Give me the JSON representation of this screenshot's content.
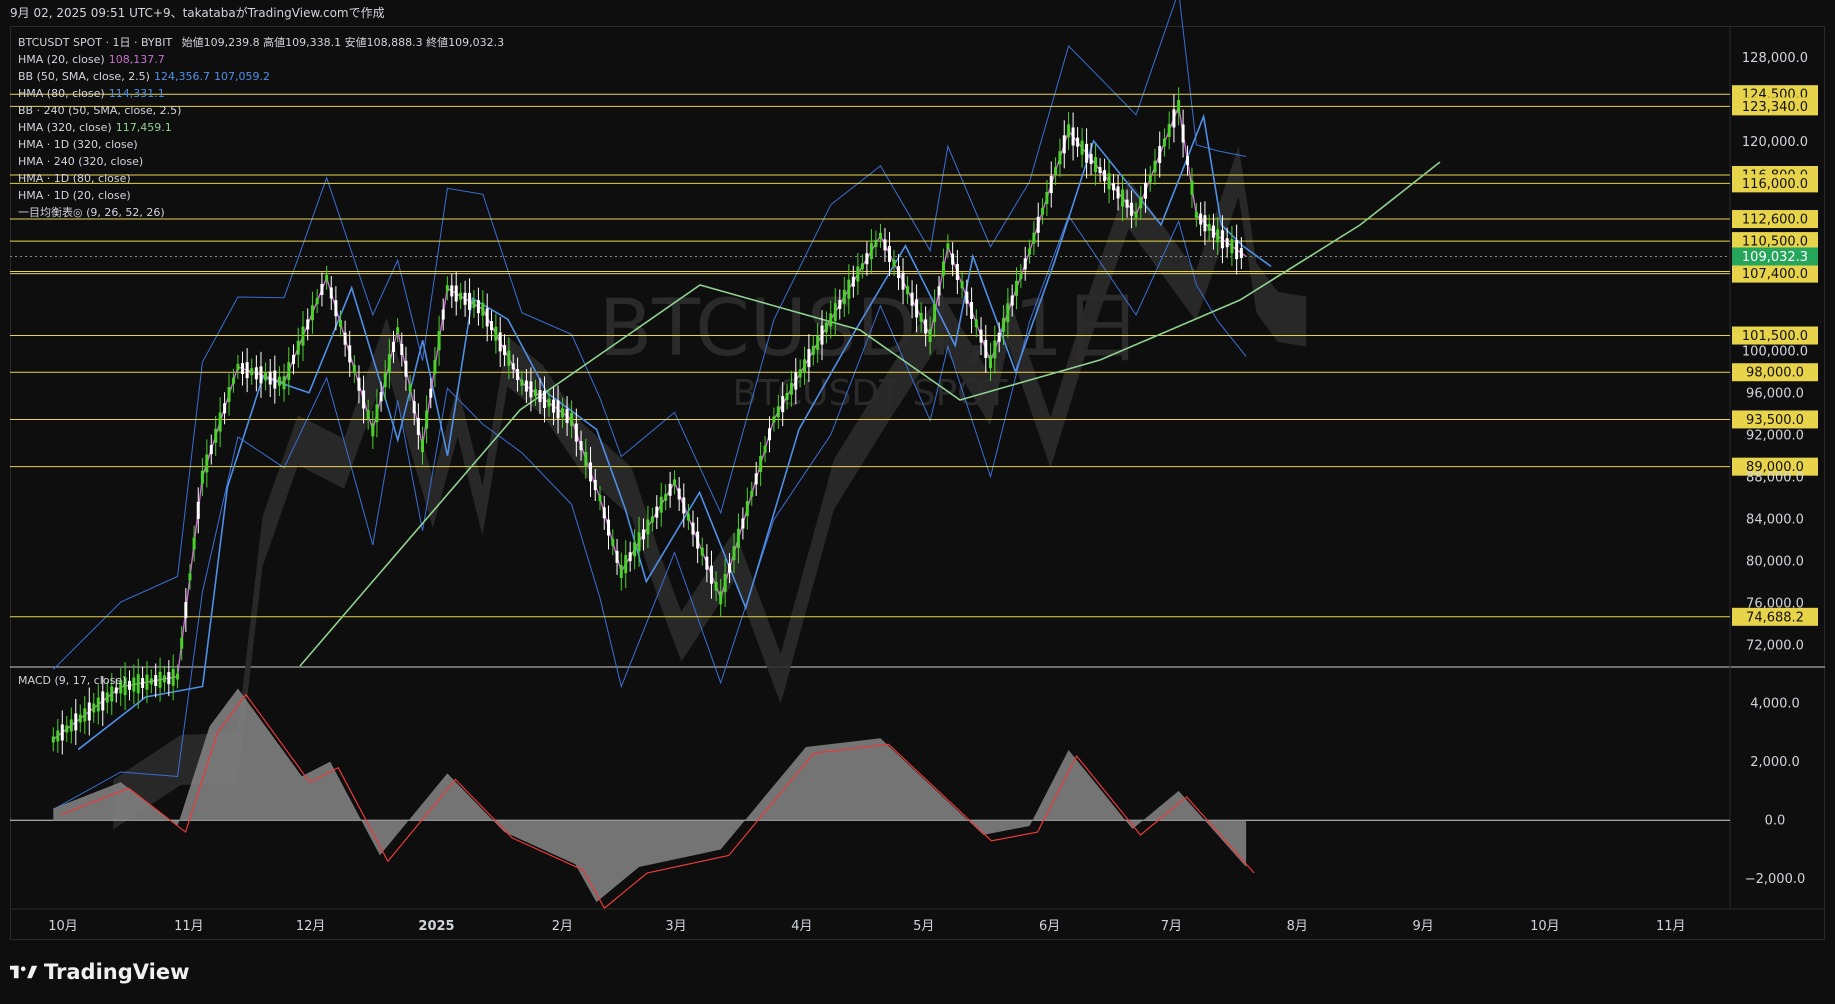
{
  "header": {
    "caption": "9月 02, 2025 09:51 UTC+9、takatabaがTradingView.comで作成"
  },
  "legend": {
    "symbol_line": "BTCUSDT SPOT · 1日 · BYBIT",
    "ohlc": {
      "open_label": "始値",
      "open": "109,239.8",
      "high_label": "高値",
      "high": "109,338.1",
      "low_label": "安値",
      "low": "108,888.3",
      "close_label": "終値",
      "close": "109,032.3"
    },
    "indicators": [
      {
        "label": "HMA (20, close)",
        "values": [
          "108,137.7"
        ],
        "colors": [
          "#c96fd0"
        ]
      },
      {
        "label": "BB (50, SMA, close, 2.5)",
        "values": [
          "124,356.7",
          "107,059.2"
        ],
        "colors": [
          "#4f8fe6",
          "#4f8fe6"
        ]
      },
      {
        "label": "HMA (80, close)",
        "values": [
          "114,331.1"
        ],
        "colors": [
          "#4f8fe6"
        ]
      },
      {
        "label": "BB · 240 (50, SMA, close, 2.5)",
        "values": [],
        "colors": []
      },
      {
        "label": "HMA (320, close)",
        "values": [
          "117,459.1"
        ],
        "colors": [
          "#8fd18f"
        ]
      },
      {
        "label": "HMA · 1D (320, close)",
        "values": [],
        "colors": []
      },
      {
        "label": "HMA · 240 (320, close)",
        "values": [],
        "colors": []
      },
      {
        "label": "HMA · 1D (80, close)",
        "values": [],
        "colors": []
      },
      {
        "label": "HMA · 1D (20, close)",
        "values": [],
        "colors": []
      },
      {
        "label": "一目均衡表◎ (9, 26, 52, 26)",
        "values": [],
        "colors": []
      }
    ]
  },
  "watermark": {
    "big": "BTCUSDT, 1日",
    "small": "BTCUSDT SPOT"
  },
  "macd": {
    "label": "MACD (9, 17, close)"
  },
  "footer": {
    "brand": "TradingView"
  },
  "colors": {
    "bg": "#0e0e0e",
    "up": "#4ad12a",
    "down": "#ffffff",
    "level": "#e8d44a",
    "hma20": "#c96fd0",
    "hma80": "#4f8fe6",
    "hma320": "#8fd18f",
    "bb": "#3b6fd6",
    "macd_hist": "#808080",
    "macd_signal": "#e83a3a",
    "last_price": "#26a65b"
  },
  "chart_data": {
    "type": "line",
    "title": "BTCUSDT SPOT · 1日 · BYBIT",
    "y_axis": {
      "ylim": [
        70000,
        131000
      ],
      "ticks": [
        {
          "v": 128000,
          "t": "128,000.0"
        },
        {
          "v": 120000,
          "t": "120,000.0"
        },
        {
          "v": 100000,
          "t": "100,000.0"
        },
        {
          "v": 96000,
          "t": "96,000.0"
        },
        {
          "v": 92000,
          "t": "92,000.0"
        },
        {
          "v": 88000,
          "t": "88,000.0"
        },
        {
          "v": 84000,
          "t": "84,000.0"
        },
        {
          "v": 80000,
          "t": "80,000.0"
        },
        {
          "v": 76000,
          "t": "76,000.0"
        },
        {
          "v": 72000,
          "t": "72,000.0"
        }
      ]
    },
    "x_axis": {
      "labels": [
        {
          "t": "10月",
          "d": 0
        },
        {
          "t": "11月",
          "d": 31
        },
        {
          "t": "12月",
          "d": 61
        },
        {
          "t": "2025",
          "d": 92
        },
        {
          "t": "2月",
          "d": 123
        },
        {
          "t": "3月",
          "d": 151
        },
        {
          "t": "4月",
          "d": 182
        },
        {
          "t": "5月",
          "d": 212
        },
        {
          "t": "6月",
          "d": 243
        },
        {
          "t": "7月",
          "d": 273
        },
        {
          "t": "8月",
          "d": 304
        },
        {
          "t": "9月",
          "d": 335
        },
        {
          "t": "10月",
          "d": 365
        },
        {
          "t": "11月",
          "d": 396
        }
      ]
    },
    "levels": [
      {
        "v": 124500,
        "t": "124,500.0"
      },
      {
        "v": 123340,
        "t": "123,340.0"
      },
      {
        "v": 116800,
        "t": "116,800.0"
      },
      {
        "v": 116000,
        "t": "116,000.0"
      },
      {
        "v": 112600,
        "t": "112,600.0"
      },
      {
        "v": 110500,
        "t": "110,500.0"
      },
      {
        "v": 107600,
        "t": "107,600.0"
      },
      {
        "v": 107400,
        "t": "107,400.0"
      },
      {
        "v": 101500,
        "t": "101,500.0"
      },
      {
        "v": 98000,
        "t": "98,000.0"
      },
      {
        "v": 93500,
        "t": "93,500.0"
      },
      {
        "v": 89000,
        "t": "89,000.0"
      },
      {
        "v": 74688.2,
        "t": "74,688.2"
      }
    ],
    "last_price": {
      "v": 109032.3,
      "t": "109,032.3"
    },
    "price_path": [
      {
        "x": "2024-10-01",
        "y": 63000
      },
      {
        "x": "2024-10-20",
        "y": 68000
      },
      {
        "x": "2024-11-05",
        "y": 69000
      },
      {
        "x": "2024-11-12",
        "y": 88000
      },
      {
        "x": "2024-11-22",
        "y": 98500
      },
      {
        "x": "2024-12-05",
        "y": 97000
      },
      {
        "x": "2024-12-17",
        "y": 107000
      },
      {
        "x": "2024-12-30",
        "y": 92500
      },
      {
        "x": "2025-01-06",
        "y": 102000
      },
      {
        "x": "2025-01-13",
        "y": 91000
      },
      {
        "x": "2025-01-20",
        "y": 106000
      },
      {
        "x": "2025-01-30",
        "y": 104000
      },
      {
        "x": "2025-02-10",
        "y": 97000
      },
      {
        "x": "2025-02-24",
        "y": 93500
      },
      {
        "x": "2025-03-04",
        "y": 86000
      },
      {
        "x": "2025-03-10",
        "y": 79000
      },
      {
        "x": "2025-03-25",
        "y": 87500
      },
      {
        "x": "2025-04-07",
        "y": 76500
      },
      {
        "x": "2025-04-22",
        "y": 93500
      },
      {
        "x": "2025-05-08",
        "y": 103000
      },
      {
        "x": "2025-05-22",
        "y": 111000
      },
      {
        "x": "2025-06-05",
        "y": 101500
      },
      {
        "x": "2025-06-10",
        "y": 110000
      },
      {
        "x": "2025-06-22",
        "y": 99000
      },
      {
        "x": "2025-07-03",
        "y": 109500
      },
      {
        "x": "2025-07-14",
        "y": 121000
      },
      {
        "x": "2025-08-02",
        "y": 113000
      },
      {
        "x": "2025-08-14",
        "y": 123340
      },
      {
        "x": "2025-08-19",
        "y": 113000
      },
      {
        "x": "2025-08-25",
        "y": 111000
      },
      {
        "x": "2025-09-02",
        "y": 109032
      }
    ],
    "macd_axis": {
      "ylim": [
        -3000,
        5200
      ],
      "ticks": [
        {
          "v": 4000,
          "t": "4,000.0"
        },
        {
          "v": 2000,
          "t": "2,000.0"
        },
        {
          "v": 0,
          "t": "0.0"
        },
        {
          "v": -2000,
          "t": "−2,000.0"
        }
      ]
    },
    "macd_path": [
      {
        "x": "2024-10-01",
        "y": 400
      },
      {
        "x": "2024-10-20",
        "y": 1300
      },
      {
        "x": "2024-11-05",
        "y": -200
      },
      {
        "x": "2024-11-14",
        "y": 3200
      },
      {
        "x": "2024-11-22",
        "y": 4500
      },
      {
        "x": "2024-12-10",
        "y": 1500
      },
      {
        "x": "2024-12-18",
        "y": 2000
      },
      {
        "x": "2025-01-01",
        "y": -1200
      },
      {
        "x": "2025-01-20",
        "y": 1600
      },
      {
        "x": "2025-02-05",
        "y": -400
      },
      {
        "x": "2025-02-25",
        "y": -1500
      },
      {
        "x": "2025-03-03",
        "y": -2800
      },
      {
        "x": "2025-03-15",
        "y": -1600
      },
      {
        "x": "2025-04-07",
        "y": -1000
      },
      {
        "x": "2025-05-01",
        "y": 2500
      },
      {
        "x": "2025-05-22",
        "y": 2800
      },
      {
        "x": "2025-06-20",
        "y": -500
      },
      {
        "x": "2025-07-03",
        "y": -200
      },
      {
        "x": "2025-07-14",
        "y": 2400
      },
      {
        "x": "2025-08-01",
        "y": -300
      },
      {
        "x": "2025-08-14",
        "y": 1000
      },
      {
        "x": "2025-09-02",
        "y": -1600
      }
    ]
  }
}
